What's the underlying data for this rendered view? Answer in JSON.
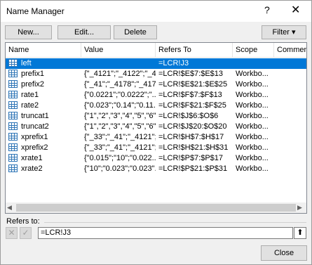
{
  "dialog": {
    "title": "Name Manager",
    "help_glyph": "?",
    "close_glyph": "✕"
  },
  "toolbar": {
    "new_label": "New...",
    "edit_label": "Edit...",
    "delete_label": "Delete",
    "filter_label": "Filter",
    "filter_arrow": "▾"
  },
  "list": {
    "columns": [
      "Name",
      "Value",
      "Refers To",
      "Scope",
      "Comment"
    ],
    "rows": [
      {
        "name": "left",
        "value": "",
        "refers": "=LCR!J3",
        "scope": "",
        "selected": true
      },
      {
        "name": "prefix1",
        "value": "{\"_4121\";\"_4122\";\"_4...",
        "refers": "=LCR!$E$7:$E$13",
        "scope": "Workbo..."
      },
      {
        "name": "prefix2",
        "value": "{\"_41\";\"_4178\";\"_417...",
        "refers": "=LCR!$E$21:$E$25",
        "scope": "Workbo..."
      },
      {
        "name": "rate1",
        "value": "{\"0.0221\";\"0.0222\";\"...",
        "refers": "=LCR!$F$7:$F$13",
        "scope": "Workbo..."
      },
      {
        "name": "rate2",
        "value": "{\"0.023\";\"0.14\";\"0.11...",
        "refers": "=LCR!$F$21:$F$25",
        "scope": "Workbo..."
      },
      {
        "name": "truncat1",
        "value": "{\"1\",\"2\",\"3\",\"4\",\"5\",\"6\"}",
        "refers": "=LCR!$J$6:$O$6",
        "scope": "Workbo..."
      },
      {
        "name": "truncat2",
        "value": "{\"1\",\"2\",\"3\",\"4\",\"5\",\"6\"}",
        "refers": "=LCR!$J$20:$O$20",
        "scope": "Workbo..."
      },
      {
        "name": "xprefix1",
        "value": "{\"_33\";\"_41\";\"_4121\";...",
        "refers": "=LCR!$H$7:$H$17",
        "scope": "Workbo..."
      },
      {
        "name": "xprefix2",
        "value": "{\"_33\";\"_41\";\"_4121\";...",
        "refers": "=LCR!$H$21:$H$31",
        "scope": "Workbo..."
      },
      {
        "name": "xrate1",
        "value": "{\"0.015\";\"10\";\"0.022...",
        "refers": "=LCR!$P$7:$P$17",
        "scope": "Workbo..."
      },
      {
        "name": "xrate2",
        "value": "{\"10\";\"0.023\";\"0.023\"...",
        "refers": "=LCR!$P$21:$P$31",
        "scope": "Workbo..."
      }
    ]
  },
  "refers_to": {
    "label": "Refers to:",
    "value": "=LCR!J3",
    "cancel_glyph": "✕",
    "confirm_glyph": "✓",
    "collapse_glyph": "⬆"
  },
  "footer": {
    "close_label": "Close"
  },
  "colors": {
    "selection": "#0078d7",
    "name_icon": "#2e75b6"
  }
}
